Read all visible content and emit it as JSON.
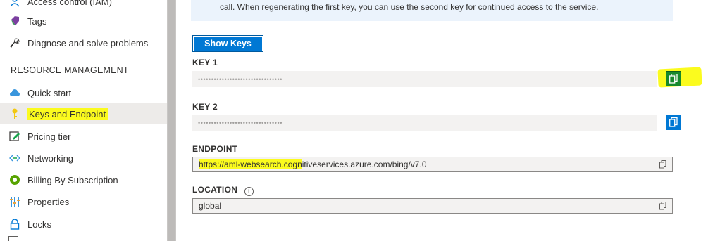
{
  "sidebar": {
    "items_top": [
      {
        "label": "Access control (IAM)",
        "icon": "people-icon"
      },
      {
        "label": "Tags",
        "icon": "tag-icon"
      },
      {
        "label": "Diagnose and solve problems",
        "icon": "wrench-icon"
      }
    ],
    "section_header": "RESOURCE MANAGEMENT",
    "items": [
      {
        "label": "Quick start",
        "icon": "cloud-icon"
      },
      {
        "label": "Keys and Endpoint",
        "icon": "key-icon"
      },
      {
        "label": "Pricing tier",
        "icon": "edit-icon"
      },
      {
        "label": "Networking",
        "icon": "networking-icon"
      },
      {
        "label": "Billing By Subscription",
        "icon": "billing-icon"
      },
      {
        "label": "Properties",
        "icon": "properties-icon"
      },
      {
        "label": "Locks",
        "icon": "lock-icon"
      }
    ]
  },
  "notice": {
    "text": "call. When regenerating the first key, you can use the second key for continued access to the service."
  },
  "show_keys_label": "Show Keys",
  "key1": {
    "label": "KEY 1",
    "value": "••••••••••••••••••••••••••••••••"
  },
  "key2": {
    "label": "KEY 2",
    "value": "••••••••••••••••••••••••••••••••"
  },
  "endpoint": {
    "label": "ENDPOINT",
    "value_highlighted": "https://aml-websearch.cogn",
    "value_rest": "itiveservices.azure.com/bing/v7.0"
  },
  "location": {
    "label": "LOCATION",
    "value": "global"
  },
  "colors": {
    "accent": "#0078d4",
    "highlight": "#fbfb1e",
    "copy_green": "#17892b"
  }
}
